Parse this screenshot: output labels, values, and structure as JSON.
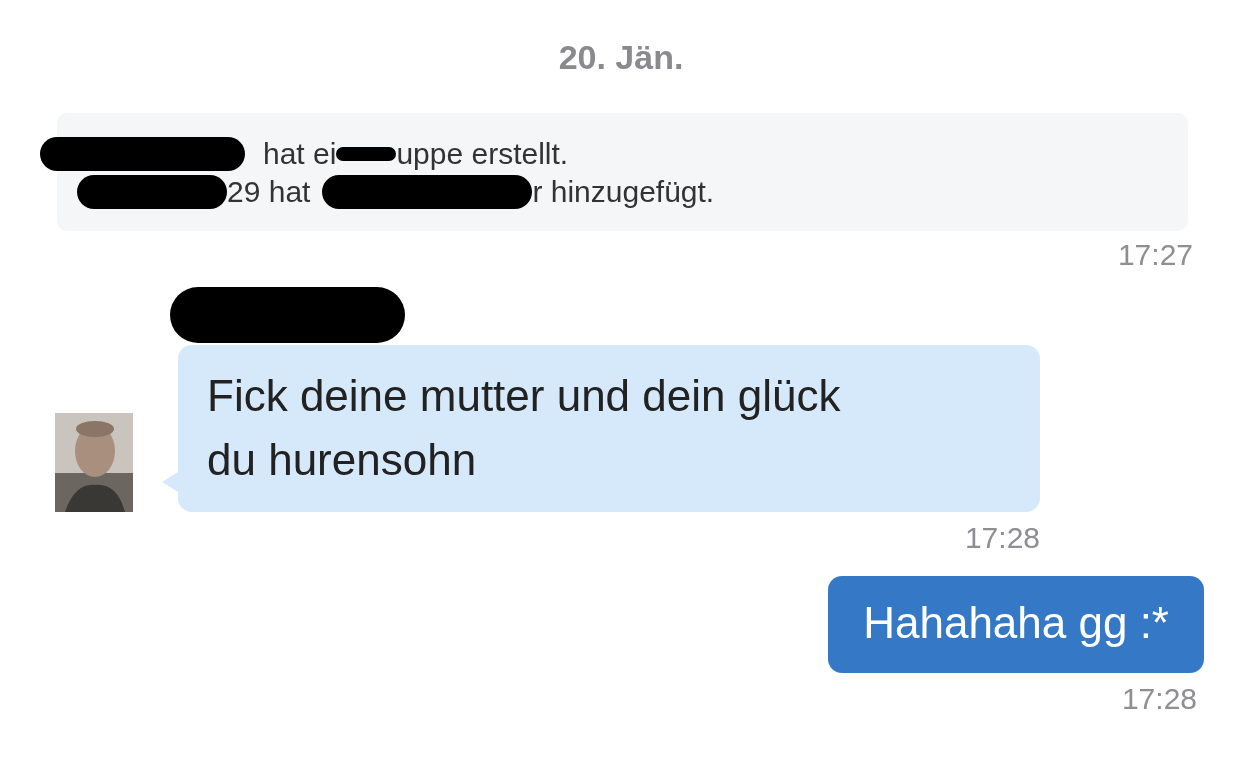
{
  "date": "20. Jän.",
  "system_notice": {
    "lines": [
      {
        "segments": [
          {
            "kind": "redacted"
          },
          {
            "kind": "text",
            "text": "hat ei"
          },
          {
            "kind": "redacted"
          },
          {
            "kind": "text",
            "text": "uppe erstellt."
          }
        ]
      },
      {
        "segments": [
          {
            "kind": "redacted"
          },
          {
            "kind": "text",
            "text": "29 hat"
          },
          {
            "kind": "redacted"
          },
          {
            "kind": "text",
            "text": "r hinzugefügt."
          }
        ]
      }
    ],
    "time": "17:27"
  },
  "messages": [
    {
      "kind": "incoming",
      "sender_redacted": true,
      "text": "Fick deine mutter und dein glück du hurensohn",
      "time": "17:28"
    },
    {
      "kind": "outgoing",
      "text": "Hahahaha gg :*",
      "time": "17:28"
    }
  ]
}
